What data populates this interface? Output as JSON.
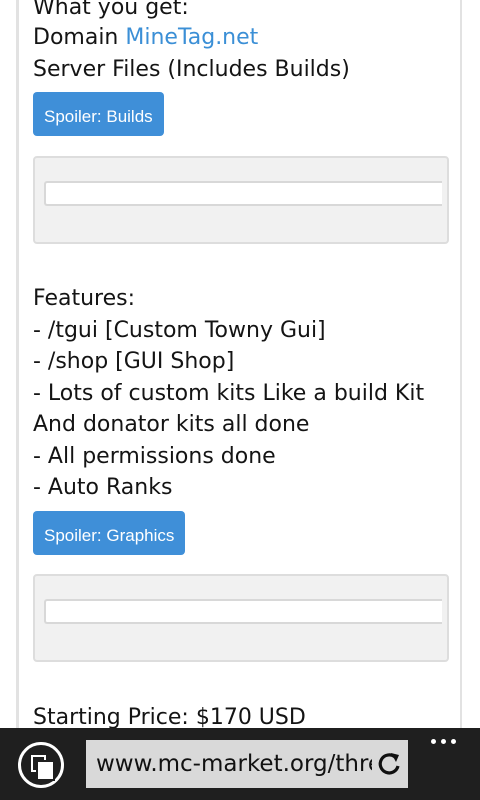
{
  "content": {
    "what_you_get": "What you get:",
    "domain_label": "Domain",
    "domain_link": "MineTag.net",
    "server_files": "Server Files (Includes Builds)",
    "spoiler_builds": "Spoiler: Builds",
    "features_heading": "Features:",
    "features": [
      "- /tgui [Custom Towny Gui]",
      "- /shop [GUI Shop]",
      "- Lots of custom kits Like a build Kit",
      "And donator kits all done",
      "- All permissions done",
      "- Auto Ranks"
    ],
    "spoiler_graphics": "Spoiler: Graphics",
    "starting_price": "Starting Price: $170 USD"
  },
  "browser": {
    "address": "www.mc-market.org/threads/",
    "tabs_icon": "tabs-icon",
    "refresh_icon": "refresh-icon",
    "more_icon": "more-icon"
  },
  "colors": {
    "link": "#3b8fd6",
    "spoiler_button": "#3f8fd8",
    "bottom_bar": "#1f1f1f",
    "address_bar": "#d9d9d9"
  }
}
